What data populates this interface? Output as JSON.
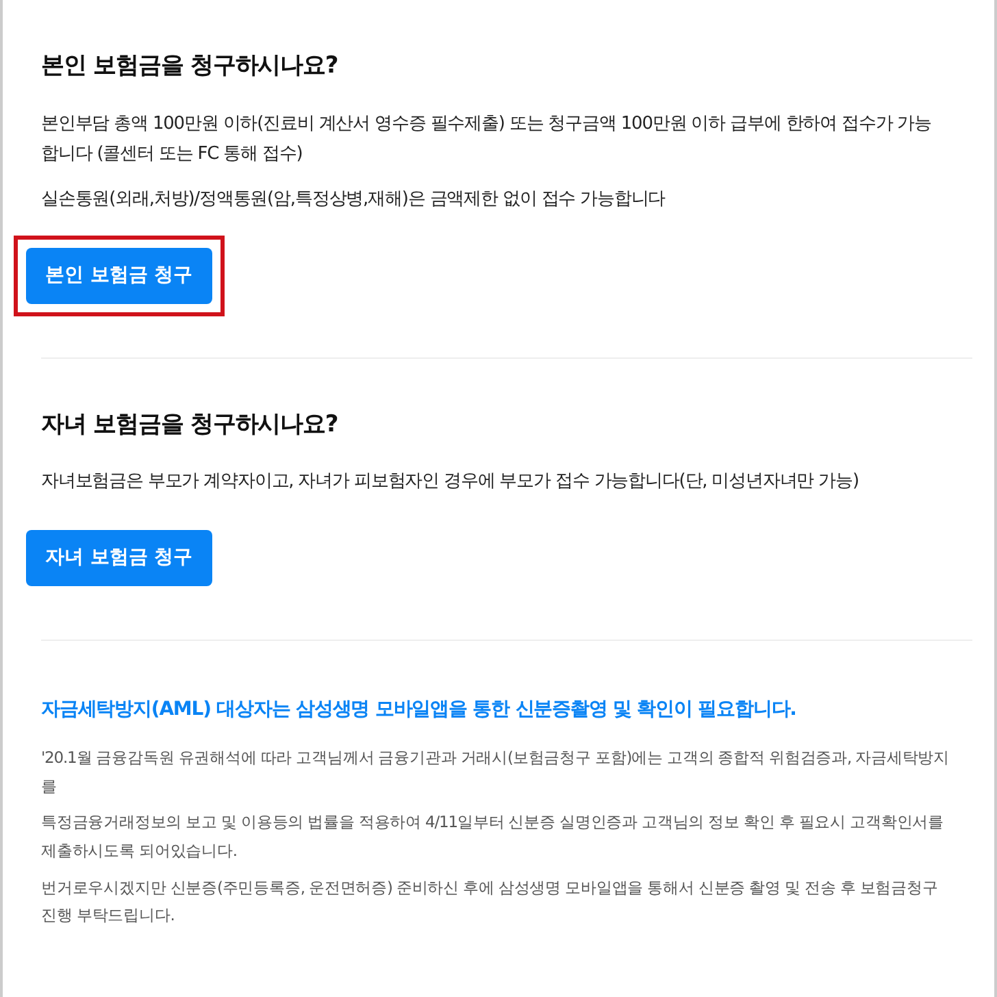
{
  "sections": [
    {
      "title": "본인 보험금을 청구하시나요?",
      "paragraphs": [
        "본인부담 총액 100만원 이하(진료비 계산서 영수증 필수제출) 또는 청구금액 100만원 이하 급부에 한하여 접수가 가능합니다 (콜센터 또는 FC 통해 접수)",
        "실손통원(외래,처방)/정액통원(암,특정상병,재해)은 금액제한 없이 접수 가능합니다"
      ],
      "button": {
        "label": "본인 보험금 청구",
        "highlighted": true
      }
    },
    {
      "title": "자녀 보험금을 청구하시나요?",
      "paragraphs": [
        "자녀보험금은 부모가 계약자이고, 자녀가 피보험자인 경우에 부모가 접수 가능합니다(단, 미성년자녀만 가능)"
      ],
      "button": {
        "label": "자녀 보험금 청구",
        "highlighted": false
      }
    }
  ],
  "notice": {
    "title": "자금세탁방지(AML) 대상자는 삼성생명 모바일앱을 통한 신분증촬영 및 확인이 필요합니다.",
    "paragraphs": [
      "'20.1월 금융감독원 유권해석에 따라 고객님께서 금융기관과 거래시(보험금청구 포함)에는 고객의 종합적 위험검증과, 자금세탁방지를",
      "특정금융거래정보의 보고 및 이용등의 법률을 적용하여 4/11일부터 신분증 실명인증과 고객님의 정보 확인 후 필요시 고객확인서를 제출하시도록 되어있습니다.",
      "번거로우시겠지만 신분증(주민등록증, 운전면허증) 준비하신 후에 삼성생명 모바일앱을 통해서 신분증 촬영 및 전송 후 보험금청구 진행 부탁드립니다."
    ]
  }
}
